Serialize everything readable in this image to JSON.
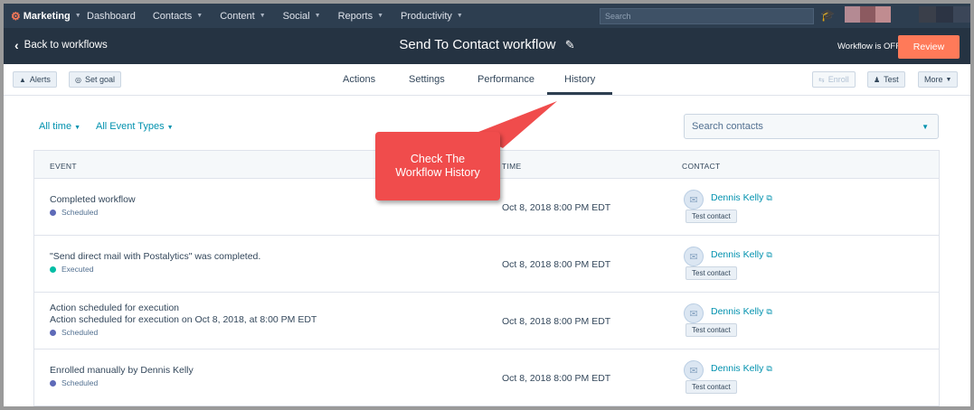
{
  "topnav": {
    "brand": "Marketing",
    "items": [
      "Dashboard",
      "Contacts",
      "Content",
      "Social",
      "Reports",
      "Productivity"
    ],
    "search_placeholder": "Search"
  },
  "header": {
    "back_label": "Back to workflows",
    "title": "Send To Contact workflow",
    "status": "Workflow is OFF",
    "review_label": "Review"
  },
  "toolbar": {
    "alerts_label": "Alerts",
    "set_goal_label": "Set goal",
    "enroll_label": "Enroll",
    "test_label": "Test",
    "more_label": "More"
  },
  "tabs": [
    "Actions",
    "Settings",
    "Performance",
    "History"
  ],
  "active_tab": "History",
  "filters": {
    "time": "All time",
    "event_types": "All Event Types",
    "search_placeholder": "Search contacts"
  },
  "table": {
    "columns": [
      "EVENT",
      "TIME",
      "CONTACT"
    ],
    "rows": [
      {
        "title": [
          "Completed workflow"
        ],
        "status": "Scheduled",
        "status_color": "#5e6ab8",
        "time": "Oct 8, 2018 8:00 PM EDT",
        "contact": "Dennis Kelly",
        "tag": "Test contact"
      },
      {
        "title": [
          "\"Send direct mail with Postalytics\" was completed."
        ],
        "status": "Executed",
        "status_color": "#00bda5",
        "time": "Oct 8, 2018 8:00 PM EDT",
        "contact": "Dennis Kelly",
        "tag": "Test contact"
      },
      {
        "title": [
          "Action scheduled for execution",
          "Action scheduled for execution on Oct 8, 2018, at 8:00 PM EDT"
        ],
        "status": "Scheduled",
        "status_color": "#5e6ab8",
        "time": "Oct 8, 2018 8:00 PM EDT",
        "contact": "Dennis Kelly",
        "tag": "Test contact"
      },
      {
        "title": [
          "Enrolled manually by Dennis Kelly"
        ],
        "status": "Scheduled",
        "status_color": "#5e6ab8",
        "time": "Oct 8, 2018 8:00 PM EDT",
        "contact": "Dennis Kelly",
        "tag": "Test contact"
      }
    ]
  },
  "callout": {
    "lines": [
      "Check The",
      "Workflow History"
    ],
    "color": "#f04c4c"
  },
  "colors": {
    "nav_bg": "#2d3e50",
    "header_bg": "#253342",
    "accent": "#ff7a59",
    "link": "#0091ae"
  }
}
